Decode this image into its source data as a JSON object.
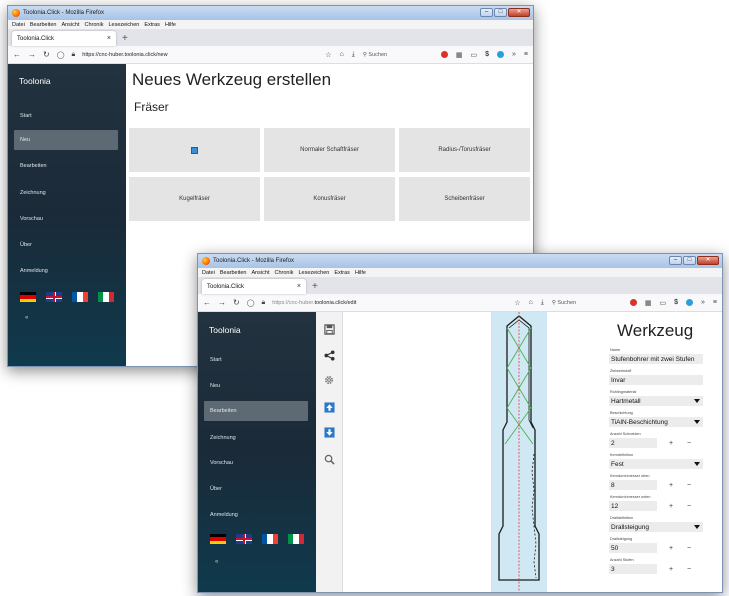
{
  "back_window": {
    "title": "Toolonia.Click - Mozilla Firefox",
    "menu": [
      "Datei",
      "Bearbeiten",
      "Ansicht",
      "Chronik",
      "Lesezeichen",
      "Extras",
      "Hilfe"
    ],
    "tab_label": "Toolonia.Click",
    "url": "https://cnc-huber.toolonia.click/new",
    "search_placeholder": "Suchen",
    "brand": "Toolonia",
    "nav": [
      "Start",
      "Neu",
      "Bearbeiten",
      "Zeichnung",
      "Vorschau",
      "Über",
      "Anmeldung"
    ],
    "page_title": "Neues Werkzeug erstellen",
    "section_title": "Fräser",
    "tiles": [
      "",
      "Normaler Schaftfräser",
      "Radius-/Torusfräser",
      "Kugelfräser",
      "Konusfräser",
      "Scheibenfräser"
    ],
    "collapse_label": "«"
  },
  "front_window": {
    "title": "Toolonia.Click - Mozilla Firefox",
    "menu": [
      "Datei",
      "Bearbeiten",
      "Ansicht",
      "Chronik",
      "Lesezeichen",
      "Extras",
      "Hilfe"
    ],
    "tab_label": "Toolonia.Click",
    "url_dim": "https://cnc-huber.",
    "url_main": "toolonia.click/edit",
    "search_placeholder": "Suchen",
    "brand": "Toolonia",
    "nav": [
      "Start",
      "Neu",
      "Bearbeiten",
      "Zeichnung",
      "Vorschau",
      "Über",
      "Anmeldung"
    ],
    "collapse_label": "«",
    "panel_title": "Werkzeug",
    "fields": {
      "name_label": "Name",
      "name_value": "Stufenbohrer mit zwei Stufen",
      "material_label": "Zielwerkstoff",
      "material_value": "Invar",
      "base_label": "Rohlingmaterial",
      "base_value": "Hartmetall",
      "coating_label": "Beschichtung",
      "coating_value": "TiAlN-Beschichtung",
      "cutters_label": "Anzahl Schneiden",
      "cutters_value": "2",
      "core_label": "Kerndefinition",
      "core_value": "Fest",
      "core_top_label": "Kerndurchmesser oben",
      "core_top_value": "8",
      "core_bottom_label": "Kerndurchmesser unten",
      "core_bottom_value": "12",
      "twist_label": "Dralldefinition",
      "twist_value": "Drallsteigung",
      "pitch_label": "Drallsteigung",
      "pitch_value": "50",
      "steps_label": "Anzahl Stufen",
      "steps_value": "3"
    },
    "plus": "+",
    "minus": "−"
  },
  "colors": {
    "sidebar_top": "#23323f",
    "sidebar_bottom": "#0f3a4d",
    "tile_bg": "#e4e4e4",
    "field_bg": "#ececec",
    "tool_fill": "#cfe8f3",
    "tool_stroke": "#1a1a1a",
    "helix_green": "#4caf50",
    "axis_red": "#e53935"
  }
}
